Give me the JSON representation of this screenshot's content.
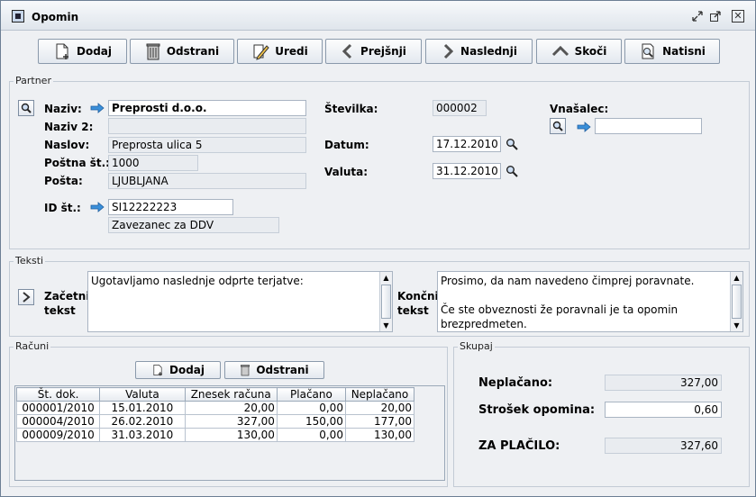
{
  "window": {
    "title": "Opomin"
  },
  "toolbar": {
    "add": "Dodaj",
    "remove": "Odstrani",
    "edit": "Uredi",
    "prev": "Prejšnji",
    "next": "Naslednji",
    "jump": "Skoči",
    "print": "Natisni"
  },
  "partner": {
    "section": "Partner",
    "naziv_label": "Naziv:",
    "naziv_value": "Preprosti d.o.o.",
    "naziv2_label": "Naziv 2:",
    "naziv2_value": "",
    "naslov_label": "Naslov:",
    "naslov_value": "Preprosta ulica 5",
    "postna_label": "Poštna št.:",
    "postna_value": "1000",
    "posta_label": "Pošta:",
    "posta_value": "LJUBLJANA",
    "id_label": "ID št.:",
    "id_value": "SI12222223",
    "ddv_value": "Zavezanec za DDV",
    "stevilka_label": "Številka:",
    "stevilka_value": "000002",
    "datum_label": "Datum:",
    "datum_value": "17.12.2010",
    "valuta_label": "Valuta:",
    "valuta_value": "31.12.2010",
    "vnasalec_label": "Vnašalec:",
    "vnasalec_value": ""
  },
  "teksti": {
    "section": "Teksti",
    "zacetni_label_1": "Začetni",
    "zacetni_label_2": "tekst",
    "zacetni_text": "Ugotavljamo naslednje odprte terjatve:",
    "koncni_label_1": "Končni",
    "koncni_label_2": "tekst",
    "koncni_line1": "Prosimo, da nam navedeno čimprej poravnate.",
    "koncni_line2": "",
    "koncni_line3": "Če ste obveznosti že poravnali je ta opomin",
    "koncni_line4": "brezpredmeten."
  },
  "racuni": {
    "section": "Računi",
    "add": "Dodaj",
    "remove": "Odstrani",
    "columns": [
      "Št. dok.",
      "Valuta",
      "Znesek računa",
      "Plačano",
      "Neplačano"
    ],
    "rows": [
      [
        "000001/2010",
        "15.01.2010",
        "20,00",
        "0,00",
        "20,00"
      ],
      [
        "000004/2010",
        "26.02.2010",
        "327,00",
        "150,00",
        "177,00"
      ],
      [
        "000009/2010",
        "31.03.2010",
        "130,00",
        "0,00",
        "130,00"
      ]
    ]
  },
  "skupaj": {
    "section": "Skupaj",
    "neplacano_label": "Neplačano:",
    "neplacano_value": "327,00",
    "strosek_label": "Strošek opomina:",
    "strosek_value": "0,60",
    "za_placilo_label": "ZA PLAČILO:",
    "za_placilo_value": "327,60"
  },
  "colors": {
    "accent": "#3a8fd9",
    "window_bg": "#eef0f3"
  },
  "icons": {
    "app": "window-app-icon",
    "search": "magnifier-icon",
    "arrow": "right-arrow-icon"
  }
}
